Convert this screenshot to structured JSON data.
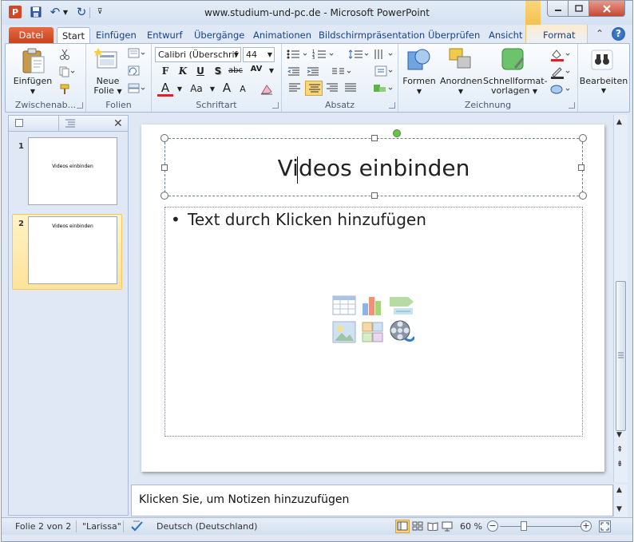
{
  "window": {
    "title": "www.studium-und-pc.de  -  Microsoft PowerPoint",
    "app_icon_letter": "P"
  },
  "quick_access": {
    "icons": [
      "save-icon",
      "undo-icon",
      "redo-icon",
      "customize-icon"
    ]
  },
  "tabs": {
    "datei": "Datei",
    "start": "Start",
    "einfuegen": "Einfügen",
    "entwurf": "Entwurf",
    "uebergaenge": "Übergänge",
    "animationen": "Animationen",
    "bildschirm": "Bildschirmpräsentation",
    "ueberpruefen": "Überprüfen",
    "ansicht": "Ansicht",
    "format": "Format"
  },
  "ribbon": {
    "zwischenablage": {
      "label": "Zwischenab...",
      "einfuegen": "Einfügen"
    },
    "folien": {
      "label": "Folien",
      "neue": "Neue",
      "folie": "Folie"
    },
    "schriftart": {
      "label": "Schriftart",
      "font": "Calibri (Überschrif",
      "size": "44",
      "bold": "F",
      "italic": "K",
      "underline": "U",
      "shadow": "S",
      "strike": "abc",
      "spacing": "AV",
      "color": "A",
      "case": "Aa",
      "grow": "A",
      "shrink": "A"
    },
    "absatz": {
      "label": "Absatz"
    },
    "zeichnung": {
      "label": "Zeichnung",
      "formen": "Formen",
      "anordnen": "Anordnen",
      "schnell1": "Schnellformat-",
      "schnell2": "vorlagen"
    },
    "bearbeiten": {
      "label": "Bearbeiten"
    }
  },
  "thumbnails": [
    {
      "num": "1",
      "title": "Videos einbinden"
    },
    {
      "num": "2",
      "title": "Videos einbinden"
    }
  ],
  "slide": {
    "title": "Videos einbinden",
    "body": "Text durch Klicken hinzufügen",
    "bullet": "•"
  },
  "notes": {
    "placeholder": "Klicken Sie, um Notizen hinzuzufügen"
  },
  "status": {
    "slide": "Folie 2 von 2",
    "theme": "\"Larissa\"",
    "language": "Deutsch (Deutschland)",
    "zoom": "60 %"
  },
  "colors": {
    "accent_orange": "#c7401b",
    "selected_tab_bg": "#fbfdff",
    "highlight": "#fde39b"
  }
}
